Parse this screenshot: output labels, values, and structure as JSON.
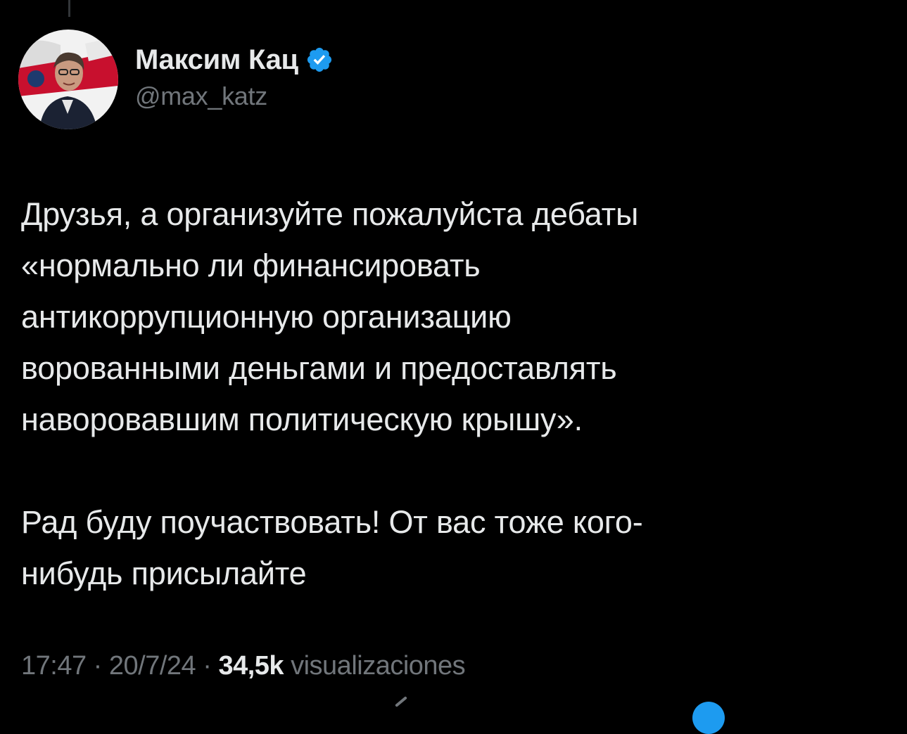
{
  "tweet": {
    "author": {
      "display_name": "Максим Кац",
      "handle": "@max_katz",
      "verified": true,
      "verified_color": "#1d9bf0",
      "avatar_icon": "profile-photo"
    },
    "text": {
      "paragraph_1": "Друзья, а организуйте пожалуйста дебаты\n«нормально ли финансировать\nантикоррупционную организацию\nворованными деньгами и предоставлять\nнаворовавшим политическую крышу».",
      "paragraph_2": "Рад буду поучаствовать! От вас тоже кого-\nнибудь присылайте"
    },
    "meta": {
      "time": "17:47",
      "separator": " · ",
      "date": "20/7/24",
      "views_count": "34,5k",
      "views_label": "visualizaciones"
    }
  },
  "colors": {
    "background": "#000000",
    "primary_text": "#e7e9ea",
    "secondary_text": "#71767b",
    "accent": "#1d9bf0"
  }
}
